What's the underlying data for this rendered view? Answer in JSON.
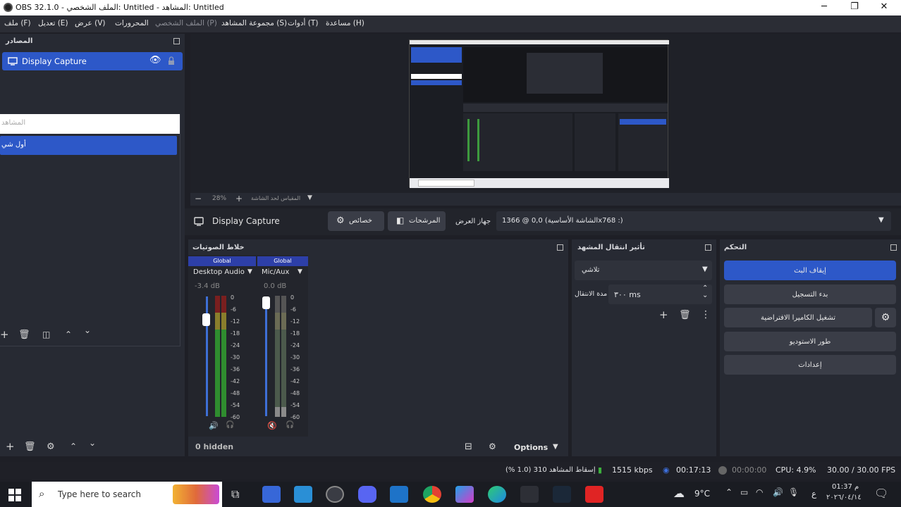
{
  "window": {
    "title": "OBS 32.1.0 - الملف الشخصي: Untitled - المشاهد: Untitled",
    "min": "─",
    "max": "❐",
    "close": "✕"
  },
  "menu": {
    "file": "ملف (F)",
    "edit": "تعديل (E)",
    "view": "عرض (V)",
    "docks": "المحرورات",
    "profile": "الملف الشخصي (P)",
    "scene_collection": "مجموعة المشاهد (S)",
    "tools": "أدوات (T)",
    "help": "مساعدة (H)"
  },
  "sources": {
    "title": "المصادر",
    "item": "Display Capture"
  },
  "scenes": {
    "search_placeholder": "المشاهد",
    "item": "أول شي"
  },
  "preview": {
    "zoom": "28%",
    "zoom_minus": "−",
    "zoom_plus": "+",
    "fit_label": "المقياس لحد الشاشة"
  },
  "props_bar": {
    "source_name": "Display Capture",
    "properties": "خصائص",
    "filters": "المرشحات",
    "display_label": "جهاز العرض",
    "display_value": "الشاشة الأساسية) 0,0 @ 1366x768 :)"
  },
  "mixer": {
    "title": "خلاط الصوتيات",
    "channels": [
      {
        "tag": "Global",
        "name": "Desktop Audio",
        "db": "-3.4 dB",
        "level": 0.78,
        "muted": false
      },
      {
        "tag": "Global",
        "name": "Mic/Aux",
        "db": "0.0 dB",
        "level": 0.94,
        "muted": true
      }
    ],
    "scale": [
      "0",
      "-6",
      "-12",
      "-18",
      "-24",
      "-30",
      "-36",
      "-42",
      "-48",
      "-54",
      "-60"
    ],
    "hidden": "0 hidden",
    "options": "Options"
  },
  "transitions": {
    "title": "تأثير انتقال المشهد",
    "selected": "تلاشي",
    "duration_label": "مدة الانتقال",
    "duration_value": "٣٠٠ ms"
  },
  "controls": {
    "title": "التحكم",
    "stream": "إيقاف البث",
    "record": "بدء التسجيل",
    "virtual_cam": "تشغيل الكاميرا الافتراضية",
    "studio": "طور الاستوديو",
    "settings": "إعدادات"
  },
  "status": {
    "dropped": "إسقاط المشاهد 310 (1.0 %)",
    "bitrate": "1515 kbps",
    "stream_time": "00:17:13",
    "rec_time": "00:00:00",
    "cpu": "CPU: 4.9%",
    "fps": "30.00 / 30.00 FPS"
  },
  "taskbar": {
    "search_placeholder": "Type here to search",
    "weather": "9°C",
    "time": "01:37 م",
    "date": "٢٠٢٦/٠٤/١٤",
    "lang": "ع"
  },
  "colors": {
    "accent": "#2d58c8",
    "panel": "#272a33",
    "bg": "#1e1f26"
  }
}
